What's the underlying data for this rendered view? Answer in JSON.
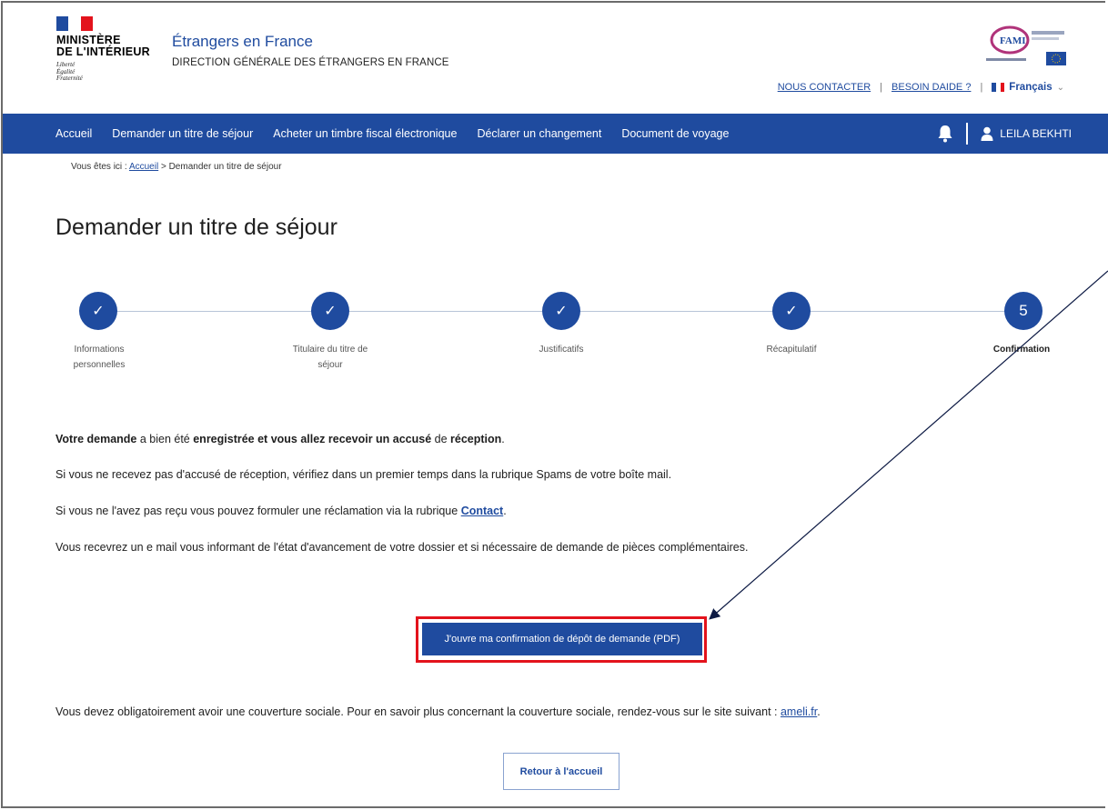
{
  "header": {
    "ministry_line1": "MINISTÈRE",
    "ministry_line2": "DE L'INTÉRIEUR",
    "motto": [
      "Liberté",
      "Égalité",
      "Fraternité"
    ],
    "site_title": "Étrangers en France",
    "site_subtitle": "DIRECTION GÉNÉRALE DES ÉTRANGERS EN FRANCE",
    "fami_logo_text": "FAMI",
    "top_links": {
      "contact": "NOUS CONTACTER",
      "help": "BESOIN DAIDE ?",
      "language": "Français"
    }
  },
  "nav": {
    "items": [
      "Accueil",
      "Demander un titre de séjour",
      "Acheter un timbre fiscal électronique",
      "Déclarer un changement",
      "Document de voyage"
    ],
    "user_name": "LEILA BEKHTI",
    "icons": [
      "bell-icon",
      "user-icon"
    ]
  },
  "breadcrumb": {
    "prefix": "Vous êtes ici :",
    "home": "Accueil",
    "current": "> Demander un titre de séjour"
  },
  "page_title": "Demander un titre de séjour",
  "stepper": {
    "steps": [
      {
        "label_line1": "Informations",
        "label_line2": "personnelles",
        "state": "done"
      },
      {
        "label_line1": "Titulaire du titre de",
        "label_line2": "séjour",
        "state": "done"
      },
      {
        "label_line1": "Justificatifs",
        "label_line2": "",
        "state": "done"
      },
      {
        "label_line1": "Récapitulatif",
        "label_line2": "",
        "state": "done"
      },
      {
        "label_line1": "Confirmation",
        "label_line2": "",
        "state": "current",
        "number": "5"
      }
    ],
    "check_symbol": "✓"
  },
  "content": {
    "line1_a": "Votre demande",
    "line1_b": " a bien été ",
    "line1_c": "enregistrée et vous allez recevoir un accusé",
    "line1_d": " de ",
    "line1_e": "réception",
    "line1_f": ".",
    "line2": "Si vous ne recevez pas d'accusé de réception, vérifiez dans un premier temps dans la rubrique Spams de votre boîte mail.",
    "line3_prefix": "Si vous ne l'avez pas reçu vous pouvez formuler une réclamation via la rubrique ",
    "line3_link": "Contact",
    "line3_suffix": ".",
    "line4": "Vous recevrez un e mail vous informant de l'état d'avancement de votre dossier et si nécessaire de demande de pièces complémentaires.",
    "pdf_button": "J'ouvre ma confirmation de dépôt de demande (PDF)",
    "social_prefix": "Vous devez obligatoirement avoir une couverture sociale. Pour en savoir plus concernant la couverture sociale, rendez-vous sur le site suivant : ",
    "social_link": "ameli.fr",
    "social_suffix": ".",
    "return_button": "Retour à l'accueil"
  },
  "colors": {
    "primary_blue": "#1f4b9f",
    "highlight_red": "#e3131c"
  }
}
